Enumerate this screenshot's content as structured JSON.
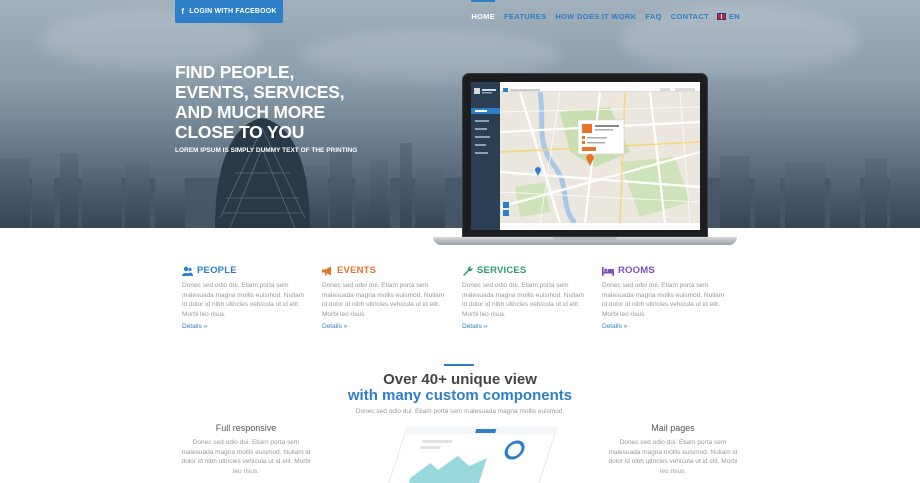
{
  "header": {
    "facebook_button": "LOGIN WITH FACEBOOK",
    "nav": [
      "HOME",
      "FEATURES",
      "HOW DOES IT WORK",
      "FAQ",
      "CONTACT"
    ],
    "lang": "EN"
  },
  "hero": {
    "title": "FIND PEOPLE, EVENTS, SERVICES, AND MUCH MORE CLOSE TO YOU",
    "subtitle": "LOREM IPSUM IS SIMPLY DUMMY TEXT OF THE PRINTING"
  },
  "features": [
    {
      "title": "PEOPLE",
      "color": "#2d7fc7",
      "icon": "people-icon",
      "text": "Donec sed odio dui. Etiam porta sem malesuada magna mollis euismod. Nullam id dolor id nibh ultricies vehicula ut id elit. Morbi leo risus.",
      "link": "Details »"
    },
    {
      "title": "EVENTS",
      "color": "#e8742c",
      "icon": "megaphone-icon",
      "text": "Donec sed odio dui. Etiam porta sem malesuada magna mollis euismod. Nullam id dolor id nibh ultricies vehicula ut id elit. Morbi leo risus.",
      "link": "Details »"
    },
    {
      "title": "SERVICES",
      "color": "#2e9a78",
      "icon": "wrench-icon",
      "text": "Donec sed odio dui. Etiam porta sem malesuada magna mollis euismod. Nullam id dolor id nibh ultricies vehicula ut id elit. Morbi leo risus.",
      "link": "Details »"
    },
    {
      "title": "ROOMS",
      "color": "#7b4fc4",
      "icon": "bed-icon",
      "text": "Donec sed odio dui. Etiam porta sem malesuada magna mollis euismod. Nullam id dolor id nibh ultricies vehicula ut id elit. Morbi leo risus.",
      "link": "Details »"
    }
  ],
  "showcase": {
    "heading_line1": "Over 40+ unique view",
    "heading_line2": "with many custom components",
    "subtitle": "Donec sed odio dui. Etiam porta sem malesuada magna mollis euismod.",
    "left": {
      "title": "Full responsive",
      "text": "Donec sed odio dui. Etiam porta sem malesuada magna mollis euismod. Nullam id dolor id nibh ultricies vehicula ut id elit. Morbi leo risus."
    },
    "right": {
      "title": "Mail pages",
      "text": "Donec sed odio dui. Etiam porta sem malesuada magna mollis euismod. Nullam id dolor id nibh ultricies vehicula ut id elit. Morbi leo risus."
    }
  }
}
